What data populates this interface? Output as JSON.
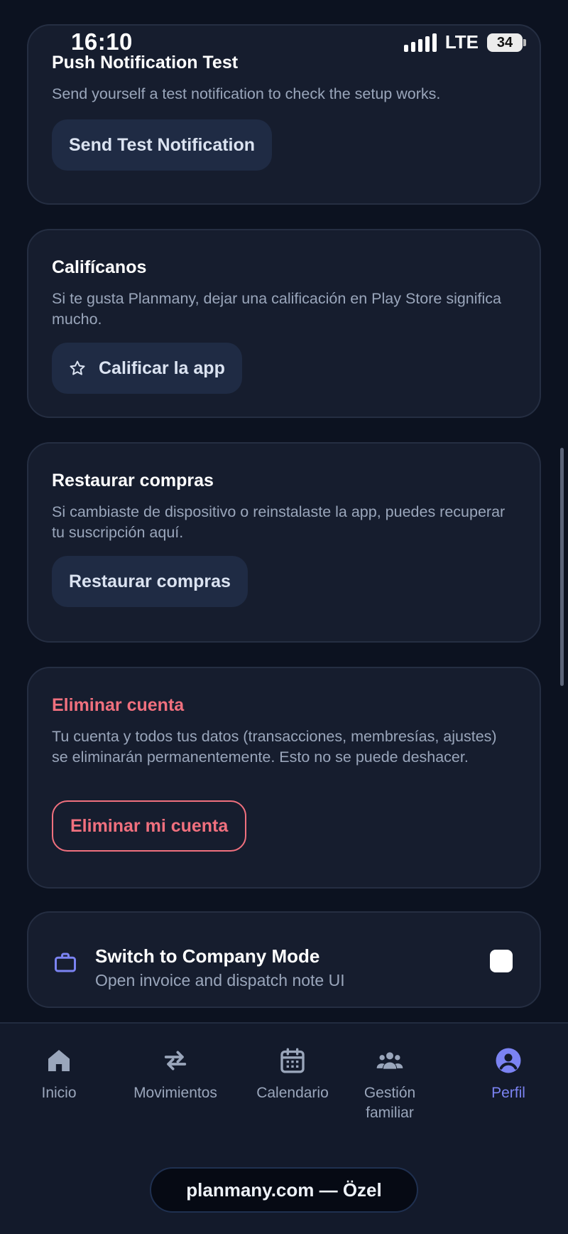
{
  "status_bar": {
    "time": "16:10",
    "network": "LTE",
    "battery": "34"
  },
  "push_test": {
    "title": "Push Notification Test",
    "description": "Send yourself a test notification to check the setup works.",
    "button_label": "Send Test Notification"
  },
  "rate": {
    "title": "Califícanos",
    "description": "Si te gusta Planmany, dejar una calificación en Play Store significa mucho.",
    "button_label": "Calificar la app",
    "button_icon": "star-icon"
  },
  "restore": {
    "title": "Restaurar compras",
    "description": "Si cambiaste de dispositivo o reinstalaste la app, puedes recuperar tu suscripción aquí.",
    "button_label": "Restaurar compras"
  },
  "delete_account": {
    "title": "Eliminar cuenta",
    "description": "Tu cuenta y todos tus datos (transacciones, membresías, ajustes) se eliminarán permanentemente. Esto no se puede deshacer.",
    "button_label": "Eliminar mi cuenta",
    "accent_color": "#f0707e"
  },
  "company_mode": {
    "title": "Switch to Company Mode",
    "subtitle": "Open invoice and dispatch note UI",
    "icon": "briefcase-icon",
    "enabled": false
  },
  "bottom_nav": {
    "items": [
      {
        "label": "Inicio",
        "icon": "home-icon",
        "active": false
      },
      {
        "label": "Movimientos",
        "icon": "transfer-arrows-icon",
        "active": false
      },
      {
        "label": "Calendario",
        "icon": "calendar-icon",
        "active": false
      },
      {
        "label": "Gestión familiar",
        "icon": "family-group-icon",
        "active": false
      },
      {
        "label": "Perfil",
        "icon": "profile-icon",
        "active": true
      }
    ],
    "active_color": "#7b83f2"
  },
  "browser": {
    "url_label": "planmany.com — Özel"
  }
}
